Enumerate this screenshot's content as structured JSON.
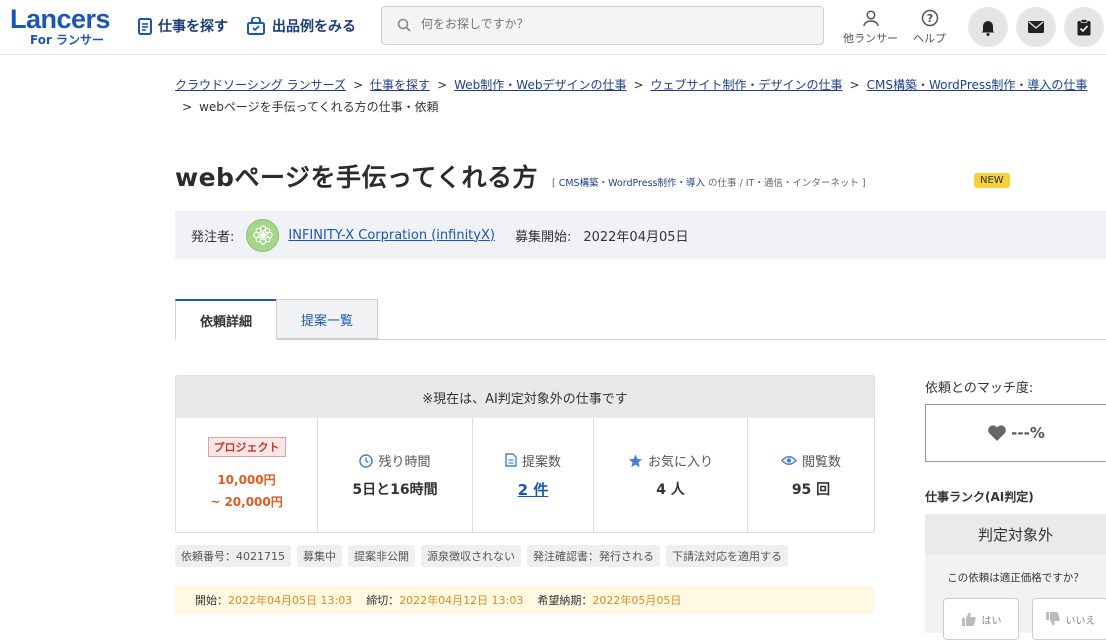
{
  "header": {
    "logo_main": "Lancers",
    "logo_sub": "For ランサー",
    "nav_find_jobs": "仕事を探す",
    "nav_portfolio": "出品例をみる",
    "search_placeholder": "何をお探しですか？",
    "other_lancer": "他ランサー",
    "help": "ヘルプ"
  },
  "breadcrumb": [
    "クラウドソーシング ランサーズ",
    "仕事を探す",
    "Web制作・Webデザインの仕事",
    "ウェブサイト制作・デザインの仕事",
    "CMS構築・WordPress制作・導入の仕事"
  ],
  "breadcrumb_current": "webページを手伝ってくれる方の仕事・依頼",
  "job": {
    "title": "webページを手伝ってくれる方",
    "cat_open": "[",
    "cat_link": "CMS構築・WordPress制作・導入",
    "cat_rest": "の仕事 / IT・通信・インターネット",
    "cat_close": "]",
    "badge": "NEW"
  },
  "client": {
    "label": "発注者:",
    "name": "INFINITY-X Corpration (infinityX)",
    "start_label": "募集開始:",
    "start_date": "2022年04月05日"
  },
  "tabs": [
    "依頼詳細",
    "提案一覧"
  ],
  "summary": {
    "notice": "※現在は、AI判定対象外の仕事です",
    "project_badge": "プロジェクト",
    "price_from": "10,000円",
    "price_to": "~ 20,000円",
    "remaining_label": "残り時間",
    "remaining_value": "5日と16時間",
    "proposals_label": "提案数",
    "proposals_value": "2 件",
    "favorites_label": "お気に入り",
    "favorites_value": "4 人",
    "views_label": "閲覧数",
    "views_value": "95 回"
  },
  "tags": [
    "依頼番号：4021715",
    "募集中",
    "提案非公開",
    "源泉徴収されない",
    "発注確認書：発行される",
    "下請法対応を適用する"
  ],
  "dates": {
    "start_label": "開始：",
    "start_value": "2022年04月05日 13:03",
    "end_label": "締切：",
    "end_value": "2022年04月12日 13:03",
    "due_label": "希望納期：",
    "due_value": "2022年05月05日"
  },
  "sidebar": {
    "match_label": "依頼とのマッチ度:",
    "match_value": "---%",
    "rank_label": "仕事ランク(AI判定)",
    "rank_value": "判定対象外",
    "rank_question": "この依頼は適正価格ですか？",
    "yes": "はい",
    "no": "いいえ"
  },
  "colors": {
    "brand": "#1a56b8",
    "price": "#e05a1e",
    "new_badge": "#f4d23d"
  }
}
